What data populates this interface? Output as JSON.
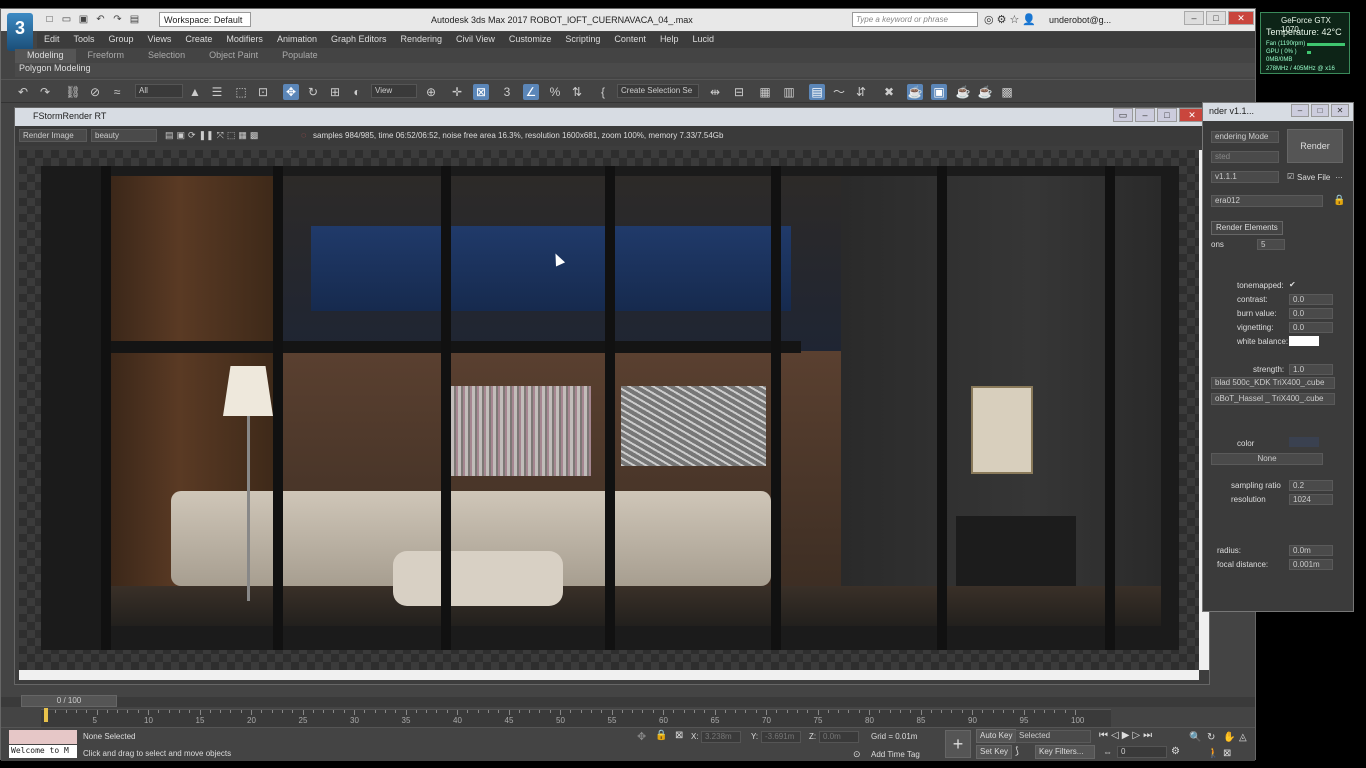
{
  "titlebar": {
    "app_title": "Autodesk 3ds Max 2017     ROBOT_lOFT_CUERNAVACA_04_.max",
    "workspace": "Workspace: Default",
    "search_placeholder": "Type a keyword or phrase",
    "user": "underobot@g...",
    "logo": "3"
  },
  "menu": [
    "Edit",
    "Tools",
    "Group",
    "Views",
    "Create",
    "Modifiers",
    "Animation",
    "Graph Editors",
    "Rendering",
    "Civil View",
    "Customize",
    "Scripting",
    "Content",
    "Help",
    "Lucid"
  ],
  "ribbon": {
    "tabs": [
      "Modeling",
      "Freeform",
      "Selection",
      "Object Paint",
      "Populate"
    ],
    "panel": "Polygon Modeling"
  },
  "toolbar": {
    "filter_dropdown": "All",
    "view_dropdown": "View",
    "selection_set": "Create Selection Se"
  },
  "fstorm": {
    "title": "FStormRender RT",
    "render_mode": "Render Image",
    "channel": "beauty",
    "stats": "samples 984/985,  time 06:52/06:52,  noise free area 16.3%,  resolution 1600x681,  zoom 100%,  memory 7.33/7.54Gb"
  },
  "timeline": {
    "frame": "0 / 100",
    "ticks": [
      "5",
      "10",
      "15",
      "20",
      "25",
      "30",
      "35",
      "40",
      "45",
      "50",
      "55",
      "60",
      "65",
      "70",
      "75",
      "80",
      "85",
      "90",
      "95",
      "100"
    ]
  },
  "status": {
    "selection": "None Selected",
    "prompt": "Click and drag to select and move objects",
    "welcome": "Welcome to M",
    "x_label": "X:",
    "x_value": "3.238m",
    "y_label": "Y:",
    "y_value": "-3.691m",
    "z_label": "Z:",
    "z_value": "0.0m",
    "grid": "Grid = 0.01m",
    "add_time_tag": "Add Time Tag",
    "auto_key": "Auto Key",
    "set_key": "Set Key",
    "key_mode": "Selected",
    "key_filters": "Key Filters...",
    "frame_field": "0"
  },
  "render_setup": {
    "title": "nder v1.1...",
    "rendering_mode": "endering Mode",
    "preset": "sted",
    "renderer": "v1.1.1",
    "save_file": "Save File",
    "camera": "era012",
    "render_button": "Render",
    "tab": "Render Elements",
    "iterations_label": "ons",
    "iterations_value": "5",
    "tonemapped": "tonemapped:",
    "contrast_label": "contrast:",
    "contrast_value": "0.0",
    "burn_label": "burn value:",
    "burn_value": "0.0",
    "vignetting_label": "vignetting:",
    "vignetting_value": "0.0",
    "white_balance_label": "white balance:",
    "strength_label": "strength:",
    "strength_value": "1.0",
    "lut1": "blad 500c_KDK TriX400_.cube",
    "lut2": "oBoT_Hassel _ TriX400_.cube",
    "color_label": "color",
    "none_label": "None",
    "sampling_ratio_label": "sampling ratio",
    "sampling_ratio_value": "0.2",
    "resolution_label": "resolution",
    "resolution_value": "1024",
    "radius_label": "radius:",
    "radius_value": "0.0m",
    "focal_label": "focal distance:",
    "focal_value": "0.001m",
    "colors": {
      "white_balance": "#ffffff",
      "color_swatch": "#3a4150"
    }
  },
  "gpu_overlay": {
    "name": "GeForce GTX 1070",
    "temperature": "Temperature: 42°C",
    "fan": "Fan (1190rpm)",
    "gpu": "GPU ( 0% )",
    "mem": "0MB/0MB",
    "clock": "278MHz / 405MHz @ x16"
  }
}
